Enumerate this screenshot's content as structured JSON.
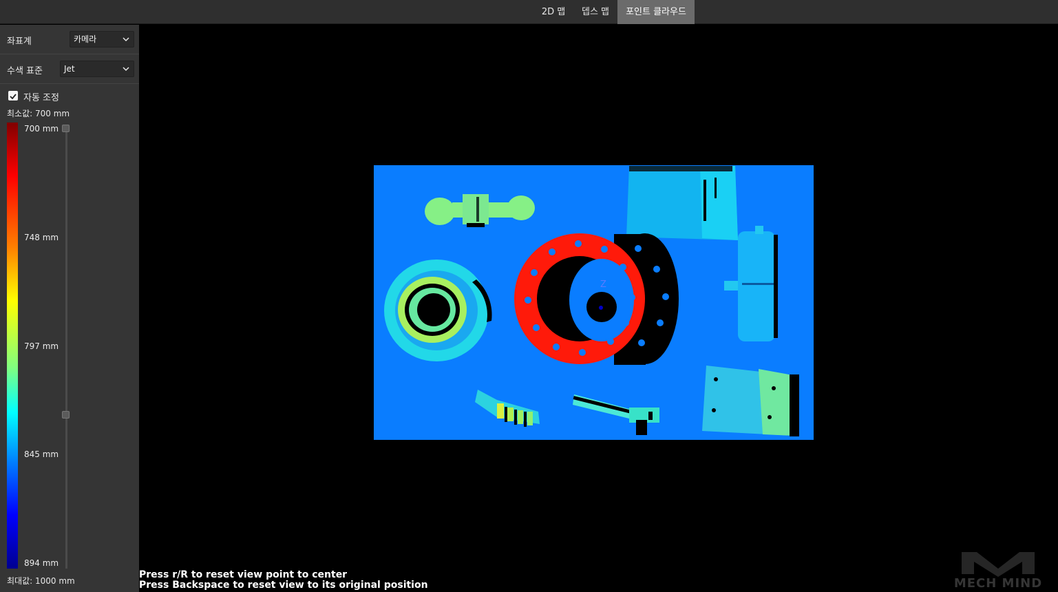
{
  "tabs": [
    {
      "label": "2D 맵",
      "active": false
    },
    {
      "label": "뎁스 맵",
      "active": false
    },
    {
      "label": "포인트 클라우드",
      "active": true
    }
  ],
  "sidebar": {
    "coord_label": "좌표계",
    "coord_value": "카메라",
    "color_label": "수색 표준",
    "color_value": "Jet",
    "auto_adjust_label": "자동 조정",
    "auto_adjust_checked": true,
    "min_label": "최소값: 700 mm",
    "max_label": "최대값: 1000 mm",
    "ticks": [
      "700 mm",
      "748 mm",
      "797 mm",
      "845 mm",
      "894 mm"
    ],
    "slider_handles": [
      0,
      0.65
    ]
  },
  "viewport": {
    "axis_label": "Z",
    "hint_line1": "Press r/R to reset view point to center",
    "hint_line2": "Press Backspace to reset view to its original position",
    "watermark": "MECH MIND"
  },
  "colors": {
    "background_plane": "#0a7dff",
    "flange": "#ff1a0a",
    "accent_tab": "#6b6b6b"
  }
}
